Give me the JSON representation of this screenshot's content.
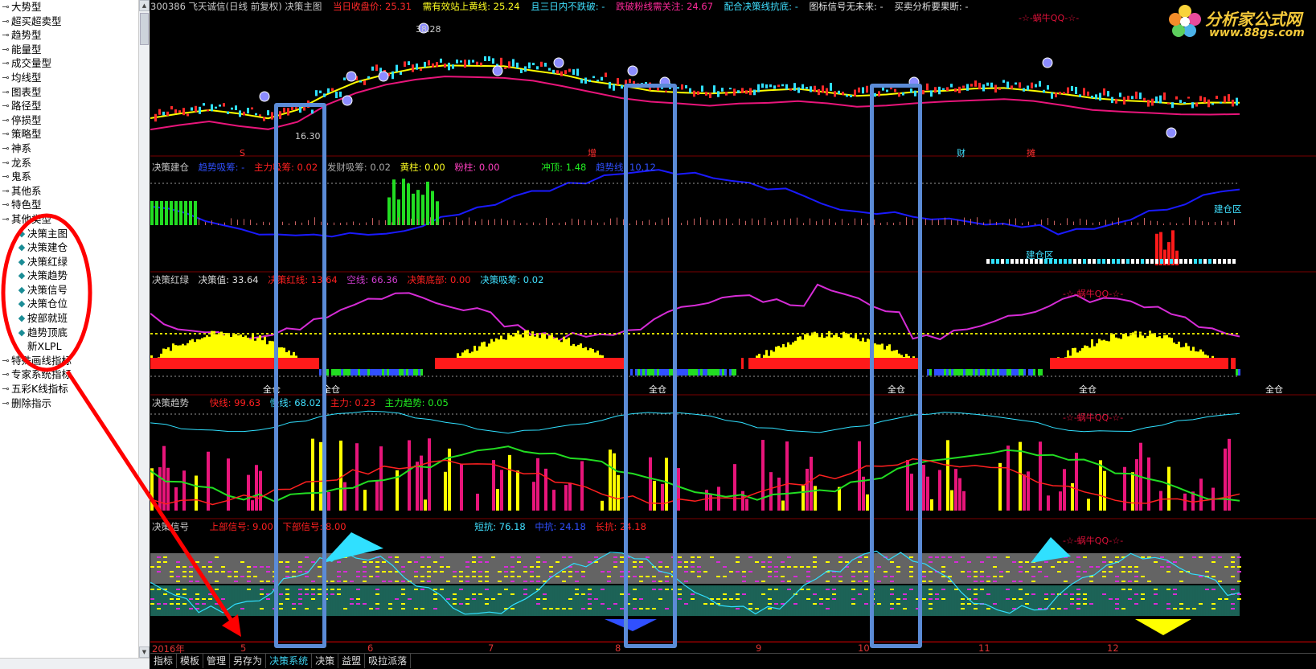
{
  "sidebar": {
    "items": [
      {
        "label": "大势型",
        "child": false
      },
      {
        "label": "超买超卖型",
        "child": false
      },
      {
        "label": "趋势型",
        "child": false
      },
      {
        "label": "能量型",
        "child": false
      },
      {
        "label": "成交量型",
        "child": false
      },
      {
        "label": "均线型",
        "child": false
      },
      {
        "label": "图表型",
        "child": false
      },
      {
        "label": "路径型",
        "child": false
      },
      {
        "label": "停损型",
        "child": false
      },
      {
        "label": "策略型",
        "child": false
      },
      {
        "label": "神系",
        "child": false
      },
      {
        "label": "龙系",
        "child": false
      },
      {
        "label": "鬼系",
        "child": false
      },
      {
        "label": "其他系",
        "child": false
      },
      {
        "label": "特色型",
        "child": false
      },
      {
        "label": "其他类型",
        "child": false
      },
      {
        "label": "决策主图",
        "child": true
      },
      {
        "label": "决策建仓",
        "child": true
      },
      {
        "label": "决策红绿",
        "child": true
      },
      {
        "label": "决策趋势",
        "child": true
      },
      {
        "label": "决策信号",
        "child": true
      },
      {
        "label": "决策仓位",
        "child": true
      },
      {
        "label": "按部就班",
        "child": true
      },
      {
        "label": "趋势顶底",
        "child": true
      },
      {
        "label": "新XLPL",
        "child": true
      },
      {
        "label": "特殊画线指标",
        "child": false
      },
      {
        "label": "专家系统指标",
        "child": false
      },
      {
        "label": "五彩K线指标",
        "child": false
      },
      {
        "label": "删除指示",
        "child": false
      }
    ]
  },
  "topbar": {
    "code_title": "300386 飞天诚信(日线 前复权) 决策主图",
    "close_label": "当日收盘价: 25.31",
    "yellow_label": "需有效站上黄线: 25.24",
    "three_day_label": "且三日内不跌破: -",
    "pink_label": "跌破粉线需关注: 24.67",
    "match_label": "配合决策线抗底: -",
    "signal_label": "图标信号无未来: -",
    "buy_label": "买卖分析要果断: -"
  },
  "logo": {
    "title": "分析家公式网",
    "url": "www.88gs.com"
  },
  "main_chart": {
    "high_label": "38.28",
    "low_label": "16.30",
    "marks": [
      "S",
      "增",
      "财",
      "摊"
    ],
    "watermark": "-☆-蜗牛QQ-☆-"
  },
  "panel_jc": {
    "title": "决策建仓",
    "trend_label": "趋势吸筹: -",
    "main_label": "主力吸筹: 0.02",
    "launch_label": "发财吸筹: 0.02",
    "yellow_label": "黄柱: 0.00",
    "pink_label": "粉柱: 0.00",
    "peak_label": "冲顶: 1.48",
    "trend_line_label": "趋势线: 10.12",
    "zone_label": "建仓区"
  },
  "panel_hl": {
    "title": "决策红绿",
    "value_label": "决策值: 33.64",
    "red_label": "决策红线: 13.64",
    "kong_label": "空线: 66.36",
    "bottom_label": "决策底部: 0.00",
    "absorb_label": "决策吸筹: 0.02",
    "full_label": "全仓"
  },
  "panel_qs": {
    "title": "决策趋势",
    "fast_label": "快线: 99.63",
    "slow_label": "慢线: 68.02",
    "main_label": "主力: 0.23",
    "main_trend_label": "主力趋势: 0.05"
  },
  "panel_xh": {
    "title": "决策信号",
    "up_label": "上部信号: 9.00",
    "down_label": "下部信号: 8.00",
    "short_label": "短抗: 76.18",
    "mid_label": "中抗: 24.18",
    "long_label": "长抗: 24.18"
  },
  "dates": [
    "2016年",
    "5",
    "6",
    "7",
    "8",
    "9",
    "10",
    "11",
    "12"
  ],
  "tabs": [
    {
      "label": "指标",
      "active": false
    },
    {
      "label": "模板",
      "active": false
    },
    {
      "label": "管理",
      "active": false
    },
    {
      "label": "另存为",
      "active": false
    },
    {
      "label": "决策系统",
      "active": true
    },
    {
      "label": "决策",
      "active": false
    },
    {
      "label": "益盟",
      "active": false
    },
    {
      "label": "吸拉派落",
      "active": false
    }
  ],
  "colors": {
    "yellow_line": "#ffff00",
    "pink_line": "#e8157a",
    "blue_line": "#1a1aff",
    "magenta_line": "#d62cd6",
    "green_bar": "#22dd22",
    "red_bar": "#ff1a1a",
    "cyan": "#30e0ff",
    "box_blue": "#5b8bd6",
    "annot_red": "#ff0000"
  }
}
